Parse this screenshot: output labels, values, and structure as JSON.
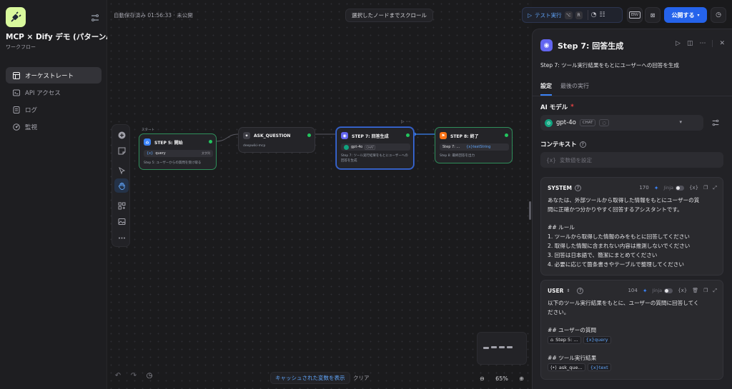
{
  "app": {
    "title": "MCP × Dify デモ (パターンA)",
    "subtitle": "ワークフロー",
    "nav": [
      {
        "label": "オーケストレート",
        "icon": "layout-icon",
        "active": true
      },
      {
        "label": "API アクセス",
        "icon": "terminal-icon",
        "active": false
      },
      {
        "label": "ログ",
        "icon": "log-icon",
        "active": false
      },
      {
        "label": "監視",
        "icon": "monitor-icon",
        "active": false
      }
    ]
  },
  "canvas": {
    "autosave": "自動保存済み 01:56:33 · 未公開",
    "scroll_to_selected": "選択したノードまでスクロール",
    "cache_vars_button": "キャッシュされた変数を表示",
    "clear_button": "クリア",
    "zoom_level": "65%",
    "start_tag": "スタート",
    "nodes": {
      "start": {
        "title": "STEP 5: 開始",
        "var_prefix": "{x}",
        "var_name": "query",
        "var_type": "文字列",
        "desc": "Step 5: ユーザーからの質問を受け取る"
      },
      "ask": {
        "title": "ASK_QUESTION",
        "desc": "deepwiki-mcp"
      },
      "llm": {
        "title": "STEP 7: 回答生成",
        "model": "gpt-4o",
        "model_badge": "CHAT",
        "desc": "Step 7: ツール実行結果をもとにユーザーへの回答を生成"
      },
      "end": {
        "title": "STEP 8: 終了",
        "chip_node": "Step 7: ...",
        "chip_var": "{x}textString",
        "desc": "Step 8: 最終回答を出力"
      }
    }
  },
  "toolbar": {
    "run_label": "テスト実行",
    "run_kbd": [
      "⌥",
      "R"
    ],
    "env_label": "ENV",
    "publish_label": "公開する"
  },
  "panel": {
    "title": "Step 7: 回答生成",
    "description": "Step 7: ツール実行結果をもとにユーザーへの回答を生成",
    "tabs": [
      "設定",
      "最後の実行"
    ],
    "ai_model_label": "AI モデル",
    "ai_model_required": "*",
    "model_name": "gpt-4o",
    "model_badge": "CHAT",
    "context_label": "コンテキスト",
    "context_placeholder": "変数値を設定",
    "context_prefix": "{x}",
    "system": {
      "role": "SYSTEM",
      "count": "170",
      "jinja": "Jinja",
      "var_icon": "{x}",
      "lines": [
        "あなたは、外部ツールから取得した情報をもとにユーザーの質",
        "問に正確かつ分かりやすく回答するアシスタントです。",
        "",
        "## ルール",
        "1. ツールから取得した情報のみをもとに回答してください",
        "2. 取得した情報に含まれない内容は推測しないでください",
        "3. 回答は日本語で、簡潔にまとめてください",
        "4. 必要に応じて箇条書きやテーブルで整理してください"
      ]
    },
    "user": {
      "role": "USER",
      "count": "104",
      "jinja": "Jinja",
      "var_icon": "{x}",
      "lines": [
        "以下のツール実行結果をもとに、ユーザーの質問に回答してく",
        "ださい。",
        "",
        "## ユーザーの質問"
      ],
      "var1_node": "Step 5: ...",
      "var1_name": "{x}query",
      "heading2": "## ツール実行結果",
      "var2_node": "ask_que...",
      "var2_name": "{x}text"
    }
  },
  "colors": {
    "accent": "#2563eb",
    "status_green": "#22c55e",
    "llm_node": "#6366f1",
    "end_node": "#f97316",
    "start_node": "#3b82f6",
    "app_icon_bg": "#d9f99d"
  }
}
